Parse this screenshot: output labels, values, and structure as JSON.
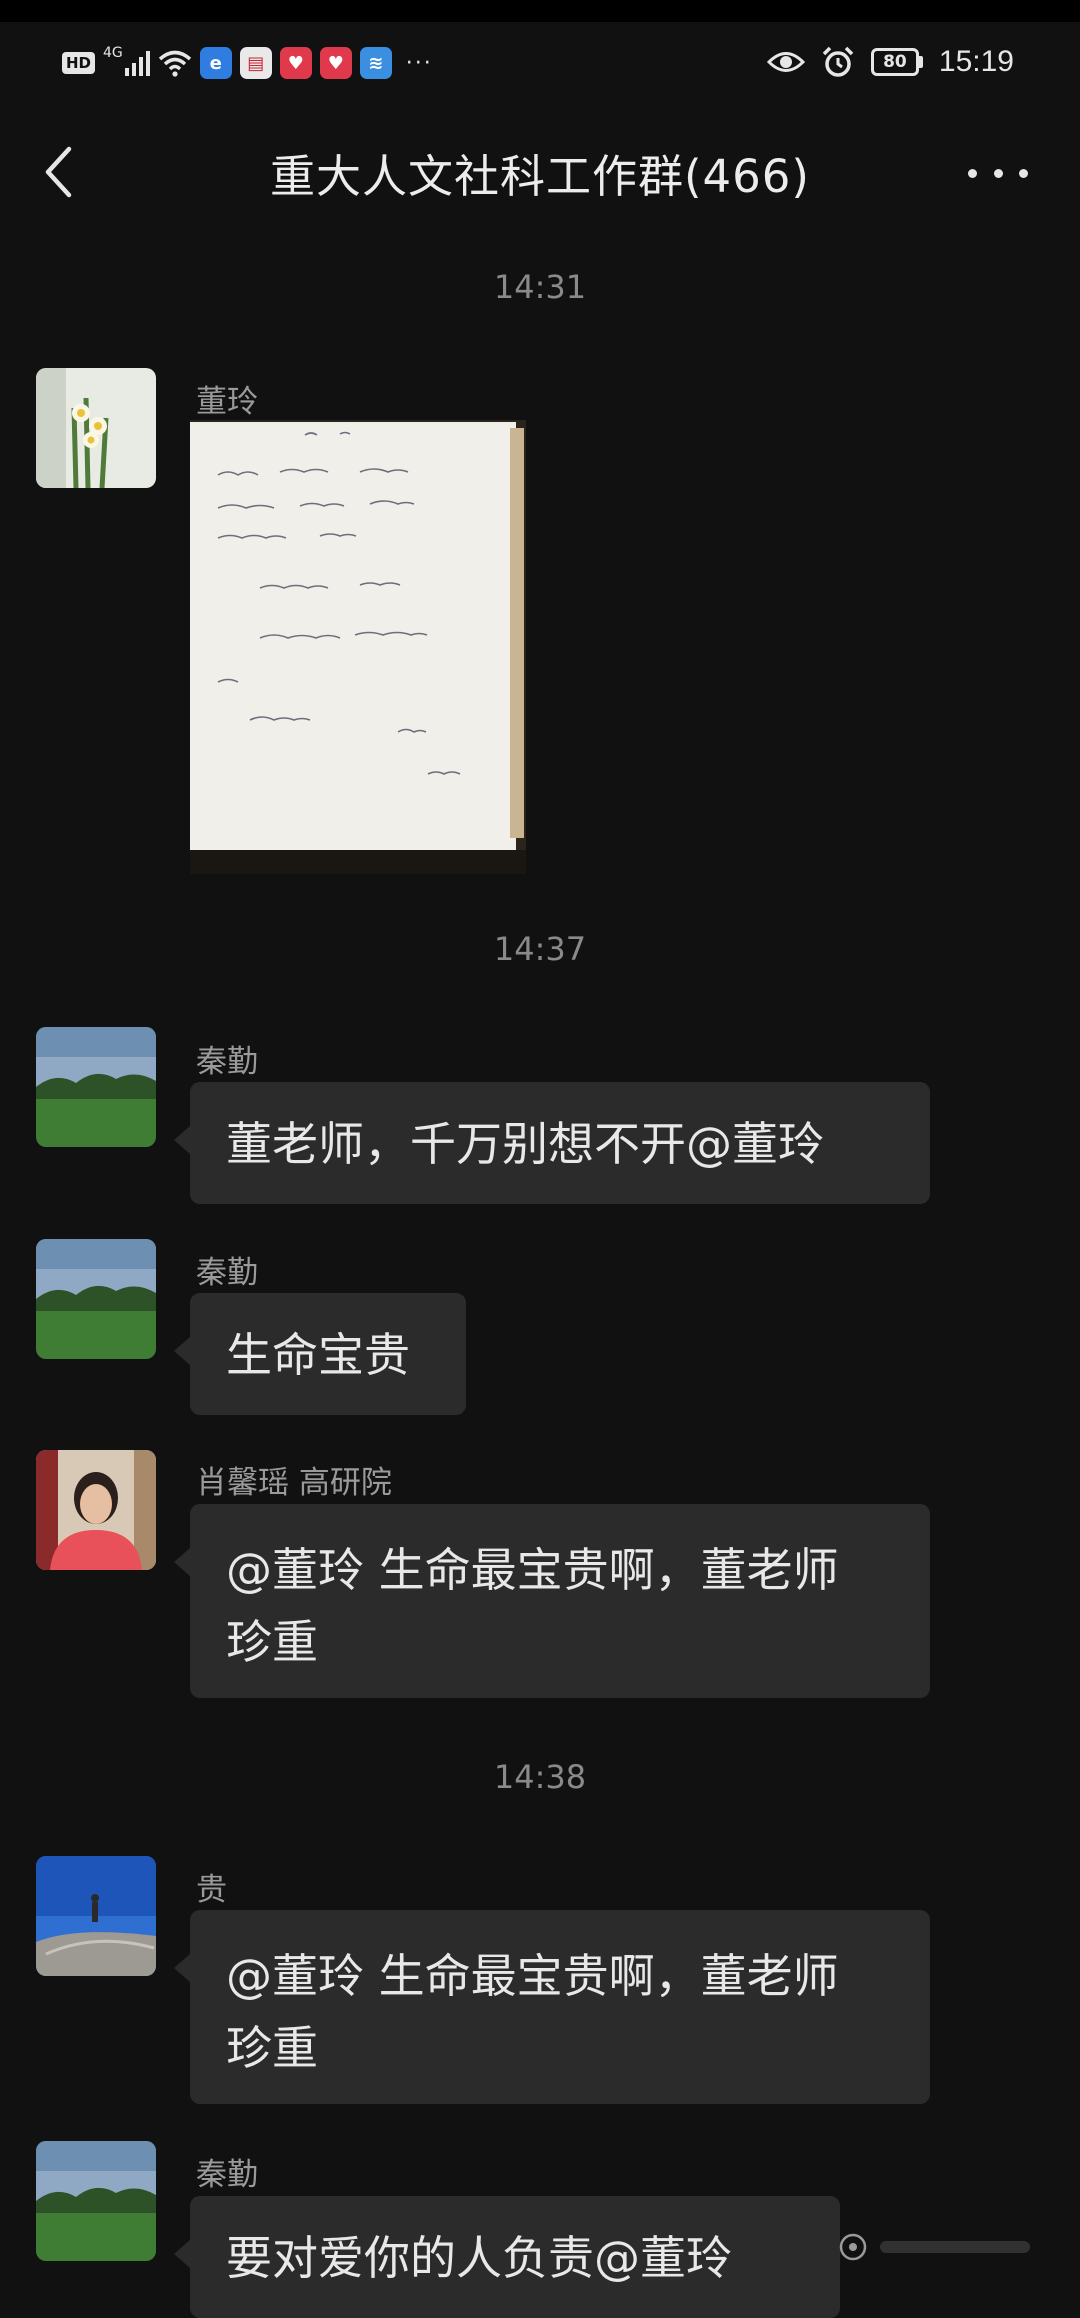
{
  "status_bar": {
    "hd_badge": "HD",
    "network": "4G",
    "more": "···",
    "battery": "80",
    "time": "15:19"
  },
  "header": {
    "title": "重大人文社科工作群(466)"
  },
  "messages": [
    {
      "type": "timestamp",
      "text": "14:31"
    },
    {
      "type": "image",
      "sender": "董玲"
    },
    {
      "type": "timestamp",
      "text": "14:37"
    },
    {
      "type": "text",
      "sender": "秦勤",
      "text": "董老师，千万别想不开@董玲"
    },
    {
      "type": "text",
      "sender": "秦勤",
      "text": "生命宝贵"
    },
    {
      "type": "text",
      "sender": "肖馨瑶 高研院",
      "lines": [
        "@董玲  生命最宝贵啊，董老师",
        "珍重"
      ]
    },
    {
      "type": "timestamp",
      "text": "14:38"
    },
    {
      "type": "text",
      "sender": "贵",
      "lines": [
        "@董玲  生命最宝贵啊，董老师",
        "珍重"
      ]
    },
    {
      "type": "text",
      "sender": "秦勤",
      "text": "要对爱你的人负责@董玲"
    }
  ],
  "colors": {
    "background": "#111111",
    "bubble": "#2b2b2b",
    "text": "#e8e8e8",
    "muted": "#8a8a8a"
  }
}
